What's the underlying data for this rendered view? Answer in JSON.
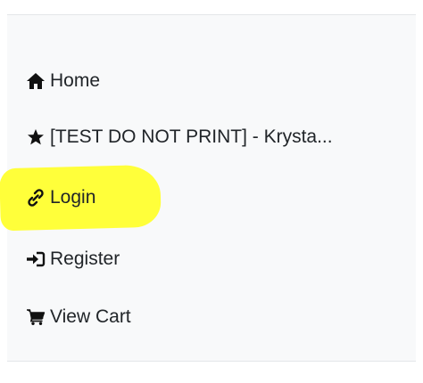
{
  "nav": {
    "items": [
      {
        "label": "Home",
        "icon": "home-icon"
      },
      {
        "label": "[TEST DO NOT PRINT] - Krysta...",
        "icon": "star-icon"
      },
      {
        "label": "Login",
        "icon": "link-icon",
        "highlighted": true
      },
      {
        "label": "Register",
        "icon": "sign-in-icon"
      },
      {
        "label": "View Cart",
        "icon": "cart-icon"
      }
    ]
  },
  "colors": {
    "highlight": "#ffff3a",
    "panel_background": "#f8f9fa",
    "text": "#212529"
  }
}
